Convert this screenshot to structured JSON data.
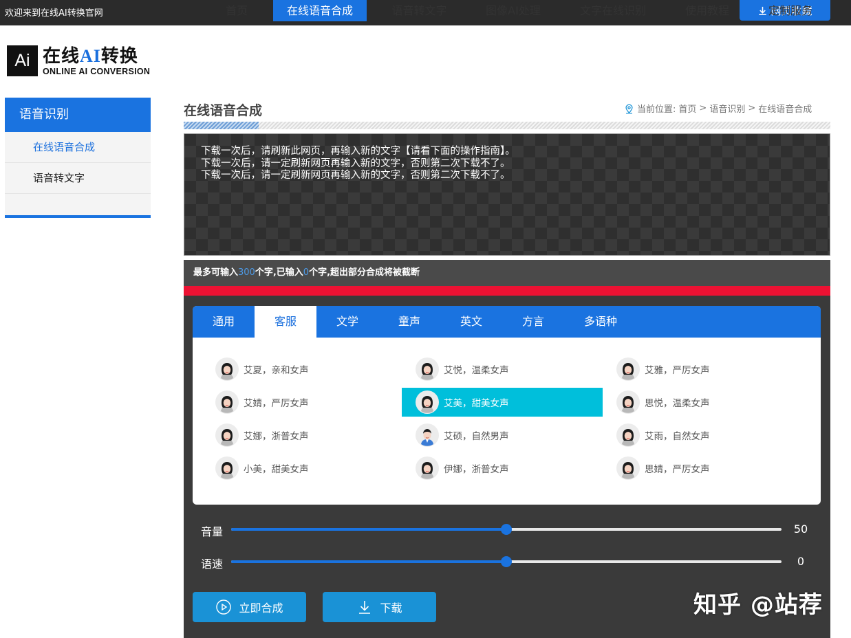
{
  "topbar": {
    "welcome": "欢迎来到在线AI转换官网",
    "favorite_label": "网页收藏"
  },
  "logo": {
    "badge": "Ai",
    "cn_prefix": "在线",
    "cn_ai": "AI",
    "cn_suffix": "转换",
    "en": "ONLINE AI CONVERSION"
  },
  "nav": {
    "items": [
      {
        "label": "首页"
      },
      {
        "label": "在线语音合成",
        "active": true
      },
      {
        "label": "语音转文字"
      },
      {
        "label": "图像AI处理"
      },
      {
        "label": "文字在线识别"
      },
      {
        "label": "使用教程"
      },
      {
        "label": "定制服务"
      }
    ]
  },
  "sidebar": {
    "heading": "语音识别",
    "items": [
      {
        "label": "在线语音合成",
        "active": true
      },
      {
        "label": "语音转文字"
      }
    ]
  },
  "main": {
    "title": "在线语音合成",
    "breadcrumb": {
      "prefix": "当前位置:",
      "items": [
        "首页",
        "语音识别",
        "在线语音合成"
      ],
      "separator": ">"
    },
    "textarea": "下载一次后，请刷新此网页，再输入新的文字【请看下面的操作指南】。\n下载一次后，请一定刷新网页再输入新的文字，否则第二次下载不了。\n下载一次后，请一定刷新网页再输入新的文字，否则第二次下载不了。",
    "counter": {
      "pre": "最多可输入",
      "max": "300",
      "mid": "个字,已输入",
      "count": "0",
      "post": "个字,超出部分合成将被截断"
    }
  },
  "voice_tabs": [
    {
      "label": "通用"
    },
    {
      "label": "客服",
      "active": true
    },
    {
      "label": "文学"
    },
    {
      "label": "童声"
    },
    {
      "label": "英文"
    },
    {
      "label": "方言"
    },
    {
      "label": "多语种"
    }
  ],
  "voices": [
    {
      "label": "艾夏，亲和女声",
      "avatar": "female-avatar-icon"
    },
    {
      "label": "艾悦，温柔女声",
      "avatar": "female-avatar-icon"
    },
    {
      "label": "艾雅，严厉女声",
      "avatar": "female-avatar-icon"
    },
    {
      "label": "艾婧，严厉女声",
      "avatar": "female-avatar-icon"
    },
    {
      "label": "艾美，甜美女声",
      "avatar": "female-avatar-icon",
      "selected": true
    },
    {
      "label": "思悦，温柔女声",
      "avatar": "female-avatar-icon"
    },
    {
      "label": "艾娜，浙普女声",
      "avatar": "female-avatar-icon"
    },
    {
      "label": "艾硕，自然男声",
      "avatar": "male-avatar-icon"
    },
    {
      "label": "艾雨，自然女声",
      "avatar": "female-avatar-icon"
    },
    {
      "label": "小美，甜美女声",
      "avatar": "female-avatar-icon"
    },
    {
      "label": "伊娜，浙普女声",
      "avatar": "female-avatar-icon"
    },
    {
      "label": "思婧，严厉女声",
      "avatar": "female-avatar-icon"
    }
  ],
  "sliders": {
    "volume": {
      "label": "音量",
      "value": "50",
      "fraction": 0.5
    },
    "speed": {
      "label": "语速",
      "value": "0",
      "fraction": 0.5
    }
  },
  "actions": {
    "synthesize": "立即合成",
    "download": "下载"
  },
  "watermark": "知乎 @站荐",
  "colors": {
    "accent": "#1a73e0",
    "selected_voice": "#00bfdb",
    "alert_bar": "#ec1233",
    "action_button": "#1a92d6"
  }
}
